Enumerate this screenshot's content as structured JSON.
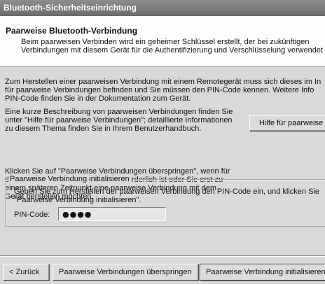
{
  "window": {
    "title": "Bluetooth-Sicherheitseinrichtung"
  },
  "header": {
    "title": "Paarweise Bluetooth-Verbindung",
    "description": "Beim paarweisen Verbinden wird ein geheimer Schlüssel erstellt, der bei zukünftigen\nVerbindungen mit diesem Gerät für die Authentifizierung und Verschlüsselung verwendet"
  },
  "body": {
    "para1": "Zum Herstellen einer paarweisen Verbindung mit einem Remotegerät muss sich dieses im In\nfür paarweise Verbindungen befinden und Sie müssen den PIN-Code kennen. Weitere Info\nPIN-Code finden Sie in der Dokumentation zum Gerät.",
    "para2": "Eine kurze Beschreibung von paarweisen Verbindungen finden Sie\nunter \"Hilfe für paarweise Verbindungen\"; detaillierte Informationen\nzu diesem Thema finden Sie in Ihrem Benutzerhandbuch.",
    "help_button": "Hilfe für paarweise",
    "para3": "Klicken Sie auf \"Paarweise Verbindungen überspringen\", wenn für\ndas Remotegerät kein PIN-Code erforderlich ist oder Sie erst zu\neinem späteren Zeitpunkt eine paarweise Verbindung mit dem\nGerät herstellen möchten."
  },
  "group": {
    "legend": "Paarweise Verbindung initialisieren",
    "description": "Geben Sie zum Herstellen der paarweisen Verbindung den PIN-Code ein, und klicken Sie\n\"Paarweise Verbindung initialisieren\".",
    "pin_label": "PIN-Code:",
    "pin_value": "●●●●"
  },
  "footer": {
    "back": "< Zurück",
    "skip": "Paarweise Verbindungen überspringen",
    "init": "Paarweise Verbindung initialisieren"
  }
}
